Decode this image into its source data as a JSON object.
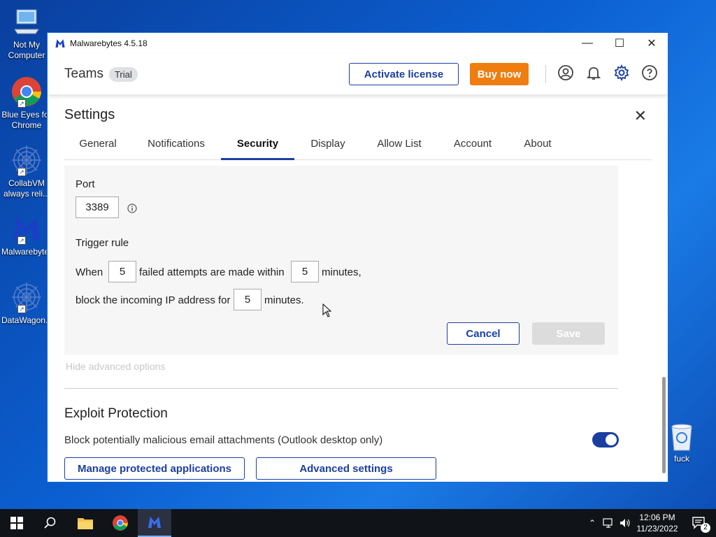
{
  "desktop": {
    "icons": [
      {
        "label": "Not My Computer",
        "icon": "computer-icon"
      },
      {
        "label": "Blue Eyes for Chrome",
        "icon": "chrome-icon"
      },
      {
        "label": "CollabVM always reli...",
        "icon": "mandala-icon"
      },
      {
        "label": "Malwarebytes",
        "icon": "malwarebytes-icon"
      },
      {
        "label": "DataWagon...",
        "icon": "mandala-icon"
      }
    ],
    "recycle_bin": {
      "label": "fuck",
      "icon": "recycle-bin-icon"
    }
  },
  "window": {
    "title": "Malwarebytes 4.5.18",
    "controls": {
      "minimize": "—",
      "maximize": "☐",
      "close": "✕"
    }
  },
  "appbar": {
    "plan": "Teams",
    "trial_badge": "Trial",
    "activate_label": "Activate license",
    "buy_label": "Buy now",
    "icons": [
      "account-icon",
      "notifications-icon",
      "settings-icon",
      "help-icon"
    ]
  },
  "settings": {
    "title": "Settings",
    "close": "✕",
    "tabs": [
      {
        "label": "General"
      },
      {
        "label": "Notifications"
      },
      {
        "label": "Security",
        "active": true
      },
      {
        "label": "Display"
      },
      {
        "label": "Allow List"
      },
      {
        "label": "Account"
      },
      {
        "label": "About"
      }
    ]
  },
  "brute_force": {
    "port_label": "Port",
    "port_value": "3389",
    "trigger_label": "Trigger rule",
    "when": "When",
    "attempts_value": "5",
    "failed_text": "failed attempts are made within",
    "within_value": "5",
    "minutes_comma": "minutes,",
    "block_text": "block the incoming IP address for",
    "block_value": "5",
    "minutes_dot": "minutes.",
    "cancel_label": "Cancel",
    "save_label": "Save",
    "hide_link": "Hide advanced options"
  },
  "exploit": {
    "title": "Exploit Protection",
    "description": "Block potentially malicious email attachments (Outlook desktop only)",
    "toggle_on": true,
    "manage_label": "Manage protected applications",
    "advanced_label": "Advanced settings"
  },
  "taskbar": {
    "time": "12:06 PM",
    "date": "11/23/2022",
    "notification_count": "2"
  },
  "colors": {
    "accent": "#1b3fa0",
    "buy": "#f07d10",
    "desktop": "#0b5fd1"
  }
}
